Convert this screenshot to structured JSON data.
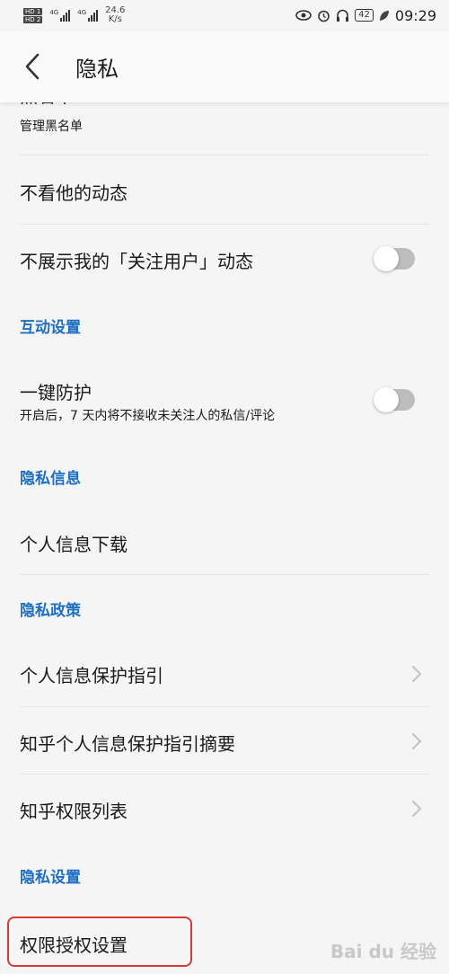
{
  "status_bar": {
    "sim1": "HD 1",
    "sim2": "HD 2",
    "net1": "4G",
    "net2": "4G",
    "speed_value": "24.6",
    "speed_unit": "K/s",
    "battery": "42",
    "time": "09:29",
    "icons": [
      "eye-icon",
      "alarm-icon",
      "headphones-icon",
      "battery-icon",
      "leaf-icon"
    ]
  },
  "header": {
    "title": "隐私",
    "back_icon": "chevron-left-icon"
  },
  "items": {
    "blacklist_title": "黑名单",
    "blacklist_sub": "管理黑名单",
    "hide_activity": "不看他的动态",
    "hide_follow": "不展示我的「关注用户」动态",
    "section_interaction": "互动设置",
    "one_click": "一键防护",
    "one_click_sub": "开启后，7 天内将不接收未关注人的私信/评论",
    "section_privacy_info": "隐私信息",
    "download_info": "个人信息下载",
    "section_policy": "隐私政策",
    "guide": "个人信息保护指引",
    "guide_summary": "知乎个人信息保护指引摘要",
    "permissions_list": "知乎权限列表",
    "section_privacy_settings": "隐私设置",
    "permission_settings": "权限授权设置"
  },
  "toggles": {
    "hide_follow_on": false,
    "one_click_on": false
  },
  "watermark": "Bai du 经验"
}
